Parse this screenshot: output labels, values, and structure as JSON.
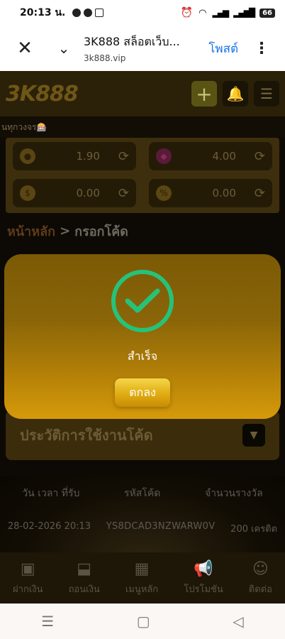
{
  "status_bar": {
    "time": "20:13 น.",
    "battery": "66"
  },
  "browser": {
    "title": "3K888 สล็อตเว็บ...",
    "url": "3k888.vip",
    "post_label": "โพสต์",
    "close_icon": "close-icon",
    "more_icon": "more-vertical-icon"
  },
  "header": {
    "logo_text": "3K888"
  },
  "marquee": {
    "text": "นทุกวงจร🎰"
  },
  "wallet": {
    "coin_value": "1.90",
    "gem_value": "4.00",
    "cash_value": "0.00",
    "bonus_value": "0.00"
  },
  "breadcrumb": {
    "home": "หน้าหลัก",
    "separator": ">",
    "current": "กรอกโค้ด"
  },
  "history_card": {
    "label": "ประวัติการใช้งานโค้ด"
  },
  "history_table": {
    "headers": [
      "วัน เวลา ที่รับ",
      "รหัสโค้ด",
      "จำนวนรางวัล"
    ],
    "rows": [
      [
        "28-02-2026 20:13",
        "YS8DCAD3NZWARW0V",
        "200 เครดิต"
      ]
    ]
  },
  "bottom_nav": [
    {
      "label": "ฝากเงิน",
      "icon": "deposit-icon"
    },
    {
      "label": "ถอนเงิน",
      "icon": "withdraw-icon"
    },
    {
      "label": "เมนูหลัก",
      "icon": "grid-menu-icon"
    },
    {
      "label": "โปรโมชัน",
      "icon": "megaphone-icon"
    },
    {
      "label": "ติดต่อ",
      "icon": "support-icon"
    }
  ],
  "modal": {
    "message": "สำเร็จ",
    "ok_label": "ตกลง",
    "accent": "#27c27a"
  }
}
